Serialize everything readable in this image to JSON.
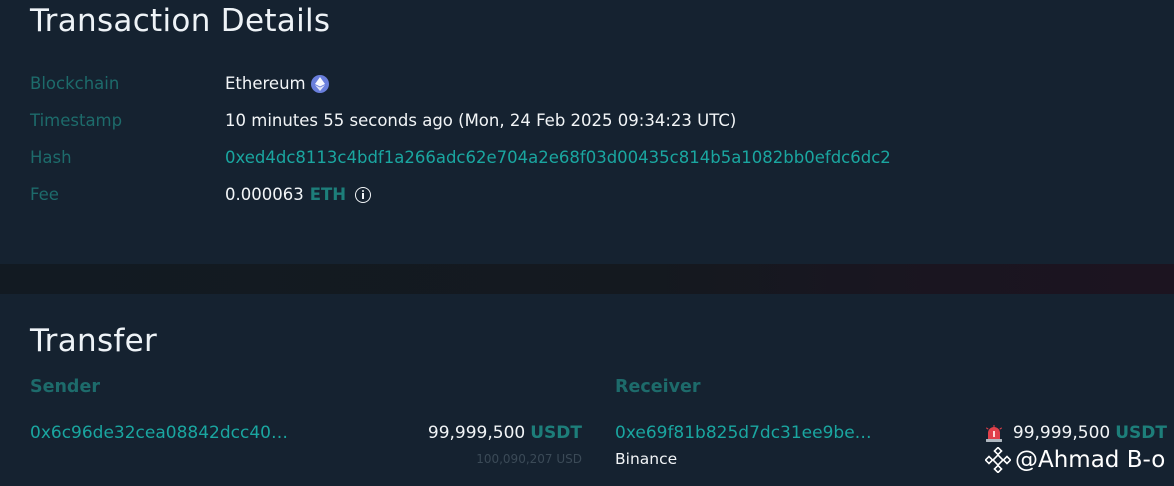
{
  "details": {
    "title": "Transaction Details",
    "rows": {
      "blockchain": {
        "label": "Blockchain",
        "value": "Ethereum",
        "icon": "ethereum-icon"
      },
      "timestamp": {
        "label": "Timestamp",
        "value": "10 minutes 55 seconds ago (Mon, 24 Feb 2025 09:34:23 UTC)"
      },
      "hash": {
        "label": "Hash",
        "value": "0xed4dc8113c4bdf1a266adc62e704a2e68f03d00435c814b5a1082bb0efdc6dc2"
      },
      "fee": {
        "label": "Fee",
        "value": "0.000063",
        "unit": "ETH",
        "icon": "info-icon"
      }
    }
  },
  "transfer": {
    "title": "Transfer",
    "sender": {
      "heading": "Sender",
      "address": "0x6c96de32cea08842dcc40…",
      "amount": "99,999,500",
      "unit": "USDT",
      "usd_value": "100,090,207 USD"
    },
    "receiver": {
      "heading": "Receiver",
      "address": "0xe69f81b825d7dc31ee9be…",
      "tag": "Binance",
      "amount": "99,999,500",
      "unit": "USDT",
      "alert_icon": "siren-icon"
    }
  },
  "watermark": {
    "text": "@Ahmad B-o",
    "icon": "binance-logo-icon"
  },
  "colors": {
    "background": "#121c26",
    "card": "#152230",
    "label": "#1d6b6b",
    "link": "#1aa6a0",
    "text": "#f2f5f7",
    "eth_badge": "#6a7fdc",
    "alert": "#e0404a"
  }
}
